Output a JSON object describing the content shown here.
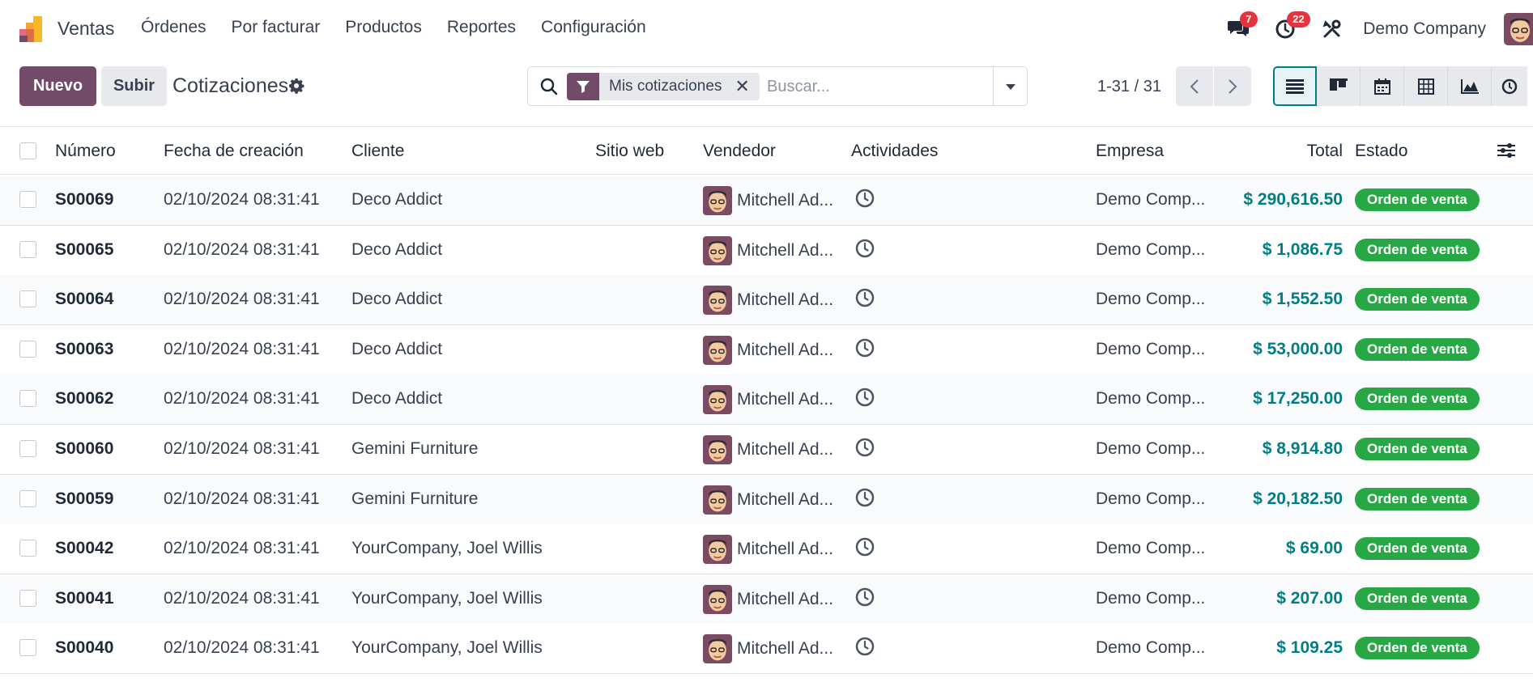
{
  "navbar": {
    "app_name": "Ventas",
    "menu": [
      "Órdenes",
      "Por facturar",
      "Productos",
      "Reportes",
      "Configuración"
    ],
    "messages_badge": "7",
    "activities_badge": "22",
    "company": "Demo Company"
  },
  "control_panel": {
    "new_label": "Nuevo",
    "upload_label": "Subir",
    "title": "Cotizaciones",
    "search": {
      "facet": "Mis cotizaciones",
      "placeholder": "Buscar..."
    },
    "pager": "1-31 / 31"
  },
  "table": {
    "headers": {
      "number": "Número",
      "created": "Fecha de creación",
      "customer": "Cliente",
      "website": "Sitio web",
      "salesperson": "Vendedor",
      "activities": "Actividades",
      "company": "Empresa",
      "total": "Total",
      "state": "Estado"
    },
    "rows": [
      {
        "number": "S00069",
        "created": "02/10/2024 08:31:41",
        "customer": "Deco Addict",
        "salesperson": "Mitchell Ad...",
        "company": "Demo Comp...",
        "total": "$ 290,616.50",
        "state": "Orden de venta"
      },
      {
        "number": "S00065",
        "created": "02/10/2024 08:31:41",
        "customer": "Deco Addict",
        "salesperson": "Mitchell Ad...",
        "company": "Demo Comp...",
        "total": "$ 1,086.75",
        "state": "Orden de venta"
      },
      {
        "number": "S00064",
        "created": "02/10/2024 08:31:41",
        "customer": "Deco Addict",
        "salesperson": "Mitchell Ad...",
        "company": "Demo Comp...",
        "total": "$ 1,552.50",
        "state": "Orden de venta"
      },
      {
        "number": "S00063",
        "created": "02/10/2024 08:31:41",
        "customer": "Deco Addict",
        "salesperson": "Mitchell Ad...",
        "company": "Demo Comp...",
        "total": "$ 53,000.00",
        "state": "Orden de venta"
      },
      {
        "number": "S00062",
        "created": "02/10/2024 08:31:41",
        "customer": "Deco Addict",
        "salesperson": "Mitchell Ad...",
        "company": "Demo Comp...",
        "total": "$ 17,250.00",
        "state": "Orden de venta"
      },
      {
        "number": "S00060",
        "created": "02/10/2024 08:31:41",
        "customer": "Gemini Furniture",
        "salesperson": "Mitchell Ad...",
        "company": "Demo Comp...",
        "total": "$ 8,914.80",
        "state": "Orden de venta"
      },
      {
        "number": "S00059",
        "created": "02/10/2024 08:31:41",
        "customer": "Gemini Furniture",
        "salesperson": "Mitchell Ad...",
        "company": "Demo Comp...",
        "total": "$ 20,182.50",
        "state": "Orden de venta"
      },
      {
        "number": "S00042",
        "created": "02/10/2024 08:31:41",
        "customer": "YourCompany, Joel Willis",
        "salesperson": "Mitchell Ad...",
        "company": "Demo Comp...",
        "total": "$ 69.00",
        "state": "Orden de venta"
      },
      {
        "number": "S00041",
        "created": "02/10/2024 08:31:41",
        "customer": "YourCompany, Joel Willis",
        "salesperson": "Mitchell Ad...",
        "company": "Demo Comp...",
        "total": "$ 207.00",
        "state": "Orden de venta"
      },
      {
        "number": "S00040",
        "created": "02/10/2024 08:31:41",
        "customer": "YourCompany, Joel Willis",
        "salesperson": "Mitchell Ad...",
        "company": "Demo Comp...",
        "total": "$ 109.25",
        "state": "Orden de venta"
      }
    ]
  },
  "icons": {
    "app_logo": "odoo-sales-logo-icon",
    "messages": "chat-bubbles-icon",
    "activities": "clock-icon",
    "debug": "tools-icon",
    "view_list": "list-view-icon",
    "view_kanban": "kanban-view-icon",
    "view_calendar": "calendar-view-icon",
    "view_pivot": "pivot-view-icon",
    "view_graph": "graph-view-icon",
    "view_activity": "activity-view-icon"
  },
  "colors": {
    "brand": "#714b67",
    "accent": "#017e84",
    "badge": "#e3343f",
    "state_green": "#28a745"
  }
}
